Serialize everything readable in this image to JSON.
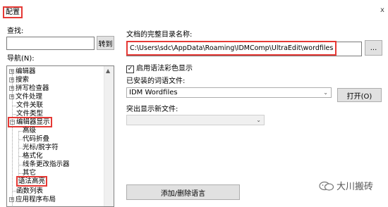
{
  "window": {
    "title": "配置",
    "close_glyph": "x"
  },
  "search": {
    "label": "查找:",
    "value": "",
    "goto_label": "转到"
  },
  "nav": {
    "label": "导航(N):",
    "items": [
      {
        "label": "编辑器",
        "level": 0,
        "expander": "+"
      },
      {
        "label": "搜索",
        "level": 0,
        "expander": "+"
      },
      {
        "label": "拼写检查器",
        "level": 0,
        "expander": "+"
      },
      {
        "label": "文件处理",
        "level": 0,
        "expander": "+"
      },
      {
        "label": "文件关联",
        "level": 0,
        "expander": ""
      },
      {
        "label": "文件类型",
        "level": 0,
        "expander": ""
      },
      {
        "label": "编辑器显示",
        "level": 0,
        "expander": "−"
      },
      {
        "label": "高级",
        "level": 1,
        "expander": ""
      },
      {
        "label": "代码折叠",
        "level": 1,
        "expander": ""
      },
      {
        "label": "光标/脱字符",
        "level": 1,
        "expander": ""
      },
      {
        "label": "格式化",
        "level": 1,
        "expander": ""
      },
      {
        "label": "线条更改指示器",
        "level": 1,
        "expander": ""
      },
      {
        "label": "其它",
        "level": 1,
        "expander": ""
      },
      {
        "label": "语法高亮",
        "level": 1,
        "expander": ""
      },
      {
        "label": "函数列表",
        "level": 0,
        "expander": ""
      },
      {
        "label": "应用程序布局",
        "level": 0,
        "expander": "+"
      }
    ]
  },
  "wordfiles": {
    "label": "文档的完整目录名称:",
    "path": "C:\\Users\\sdc\\AppData\\Roaming\\IDMComp\\UltraEdit\\wordfiles",
    "browse_label": "..."
  },
  "syntax": {
    "checkbox_label": "启用语法彩色显示",
    "checked": true,
    "check_glyph": "✓"
  },
  "installed": {
    "label": "已安装的词语文件:",
    "selected": "IDM Wordfiles",
    "open_label": "打开(O)"
  },
  "new_file": {
    "label": "突出显示新文件:",
    "selected": ""
  },
  "add_remove_label": "添加/删除语言",
  "watermark": {
    "text": "大川搬砖"
  },
  "colors": {
    "highlight": "#e53935"
  }
}
